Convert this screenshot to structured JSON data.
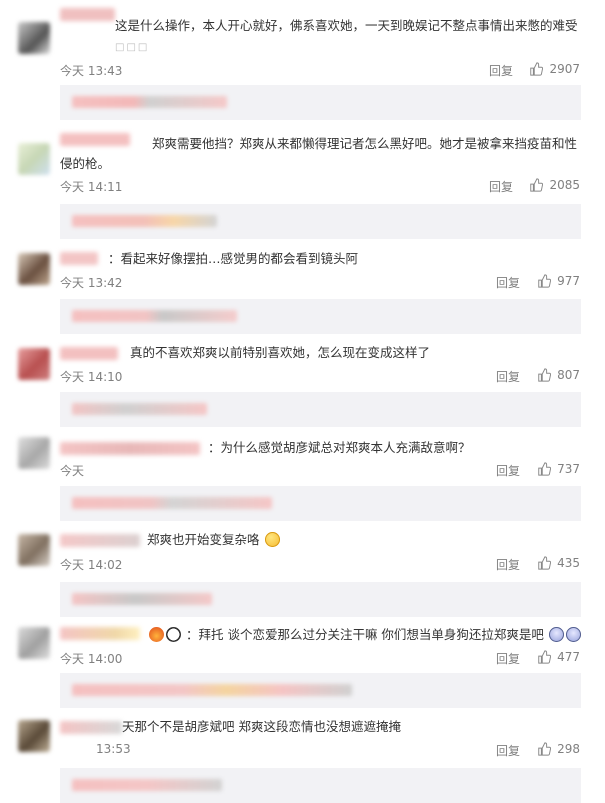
{
  "comments": [
    {
      "text": "这是什么操作，本人开心就好，佛系喜欢她，一天到晚娱记不整点事情出来憋的难受",
      "time": "今天 13:43",
      "reply": "回复",
      "likes": "2907"
    },
    {
      "text": "郑爽需要他挡？郑爽从来都懒得理记者怎么黑好吧。她才是被拿来挡疫苗和性侵的枪。",
      "time": "今天 14:11",
      "reply": "回复",
      "likes": "2085"
    },
    {
      "text": "：看起来好像摆拍…感觉男的都会看到镜头阿",
      "time": "今天 13:42",
      "reply": "回复",
      "likes": "977"
    },
    {
      "text": "真的不喜欢郑爽以前特别喜欢她，怎么现在变成这样了",
      "time": "今天 14:10",
      "reply": "回复",
      "likes": "807"
    },
    {
      "text": "：为什么感觉胡彦斌总对郑爽本人充满敌意啊？",
      "time": "今天",
      "reply": "回复",
      "likes": "737"
    },
    {
      "text": "郑爽也开始变复杂咯",
      "time": "今天 14:02",
      "reply": "回复",
      "likes": "435"
    },
    {
      "text": "：拜托 谈个恋爱那么过分关注干嘛 你们想当单身狗还拉郑爽是吧",
      "time": "今天 14:00",
      "reply": "回复",
      "likes": "477"
    },
    {
      "text": "天那个不是胡彦斌吧 郑爽这段恋情也没想遮遮掩掩",
      "time": "13:53",
      "reply": "回复",
      "likes": "298"
    }
  ],
  "colors": {
    "text": "#333333",
    "meta": "#808080",
    "subbox": "#f2f2f5",
    "blur_pink": "#f3c4c4"
  },
  "icons": {
    "like": "thumbs-up-icon"
  }
}
